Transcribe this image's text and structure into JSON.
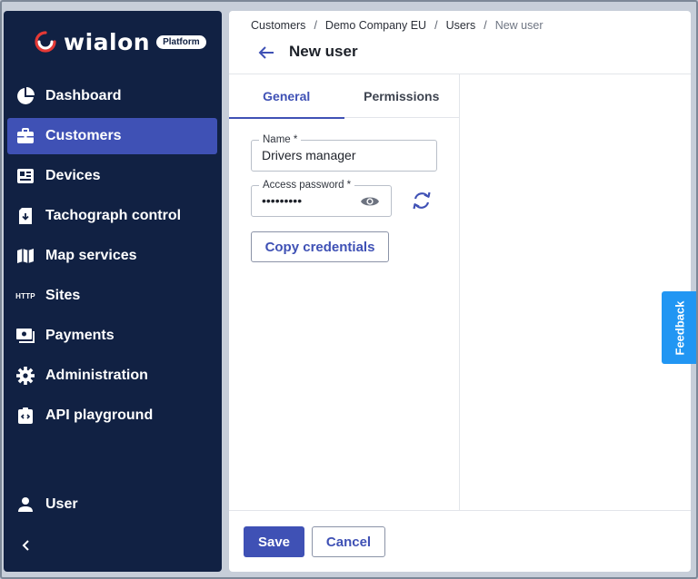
{
  "brand": {
    "logo_text": "wialon",
    "badge": "Platform",
    "accent_color": "#3f51b5",
    "sidebar_color": "#112143"
  },
  "sidebar": {
    "items": [
      {
        "label": "Dashboard",
        "icon": "pie-chart-icon"
      },
      {
        "label": "Customers",
        "icon": "briefcase-icon",
        "active": true
      },
      {
        "label": "Devices",
        "icon": "devices-card-icon"
      },
      {
        "label": "Tachograph control",
        "icon": "tachograph-download-icon"
      },
      {
        "label": "Map services",
        "icon": "map-icon"
      },
      {
        "label": "Sites",
        "icon": "http-icon",
        "icon_text": "HTTP"
      },
      {
        "label": "Payments",
        "icon": "payments-icon"
      },
      {
        "label": "Administration",
        "icon": "gear-icon"
      },
      {
        "label": "API playground",
        "icon": "code-clipboard-icon"
      }
    ],
    "user_label": "User"
  },
  "breadcrumb": {
    "items": [
      "Customers",
      "Demo Company EU",
      "Users"
    ],
    "separator": "/",
    "current": "New user"
  },
  "page": {
    "title": "New user"
  },
  "tabs": [
    {
      "label": "General",
      "active": true
    },
    {
      "label": "Permissions",
      "active": false
    }
  ],
  "form": {
    "name_label": "Name *",
    "name_value": "Drivers manager",
    "password_label": "Access password *",
    "password_value": "•••••••••",
    "copy_label": "Copy credentials"
  },
  "footer": {
    "save_label": "Save",
    "cancel_label": "Cancel"
  },
  "feedback_label": "Feedback"
}
